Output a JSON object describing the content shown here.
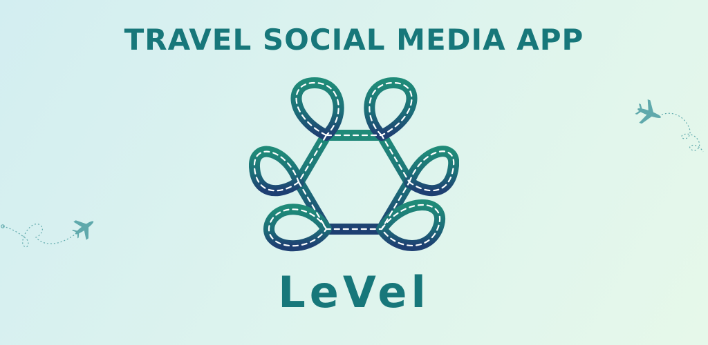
{
  "headline": "TRAVEL SOCIAL MEDIA APP",
  "brand_name": "LeVel",
  "icons": {
    "logo": "road-knot-logo",
    "plane_left": "airplane-icon",
    "plane_right": "airplane-icon"
  },
  "colors": {
    "accent": "#17777a",
    "logo_top": "#1f8a78",
    "logo_mid": "#1c6e78",
    "logo_bottom": "#1e3f72",
    "plane": "#5fa9ac"
  }
}
